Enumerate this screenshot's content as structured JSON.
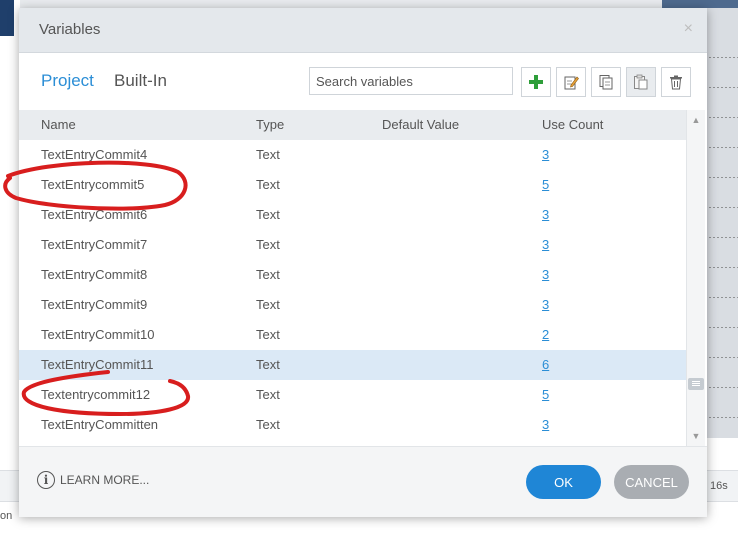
{
  "dialog": {
    "title": "Variables",
    "close_glyph": "×"
  },
  "tabs": [
    {
      "label": "Project",
      "active": true
    },
    {
      "label": "Built-In",
      "active": false
    }
  ],
  "search": {
    "placeholder": "Search variables",
    "value": ""
  },
  "toolbar": {
    "buttons": [
      {
        "icon": "plus-icon",
        "color": "#2e9e3a"
      },
      {
        "icon": "edit-icon"
      },
      {
        "icon": "copy-icon"
      },
      {
        "icon": "paste-icon",
        "disabled": true
      },
      {
        "icon": "trash-icon"
      }
    ]
  },
  "columns": {
    "name": "Name",
    "type": "Type",
    "default_value": "Default Value",
    "use_count": "Use Count"
  },
  "rows": [
    {
      "name": "TextEntryCommit4",
      "type": "Text",
      "default": "",
      "use_count": "3",
      "selected": false
    },
    {
      "name": "TextEntrycommit5",
      "type": "Text",
      "default": "",
      "use_count": "5",
      "selected": false
    },
    {
      "name": "TextEntryCommit6",
      "type": "Text",
      "default": "",
      "use_count": "3",
      "selected": false
    },
    {
      "name": "TextEntryCommit7",
      "type": "Text",
      "default": "",
      "use_count": "3",
      "selected": false
    },
    {
      "name": "TextEntryCommit8",
      "type": "Text",
      "default": "",
      "use_count": "3",
      "selected": false
    },
    {
      "name": "TextEntryCommit9",
      "type": "Text",
      "default": "",
      "use_count": "3",
      "selected": false
    },
    {
      "name": "TextEntryCommit10",
      "type": "Text",
      "default": "",
      "use_count": "2",
      "selected": false
    },
    {
      "name": "TextEntryCommit11",
      "type": "Text",
      "default": "",
      "use_count": "6",
      "selected": true
    },
    {
      "name": "Textentrycommit12",
      "type": "Text",
      "default": "",
      "use_count": "5",
      "selected": false
    },
    {
      "name": "TextEntryCommitten",
      "type": "Text",
      "default": "",
      "use_count": "3",
      "selected": false
    }
  ],
  "footer": {
    "learn_more": "LEARN MORE...",
    "ok": "OK",
    "cancel": "CANCEL"
  },
  "background": {
    "ruler_text": "16s",
    "tab_text": "on"
  },
  "colors": {
    "accent": "#2b8ed6",
    "ok_button": "#1f86d6",
    "cancel_button": "#a9adb2",
    "annotation": "#d81e1e",
    "selected_row": "#dbe9f6"
  }
}
